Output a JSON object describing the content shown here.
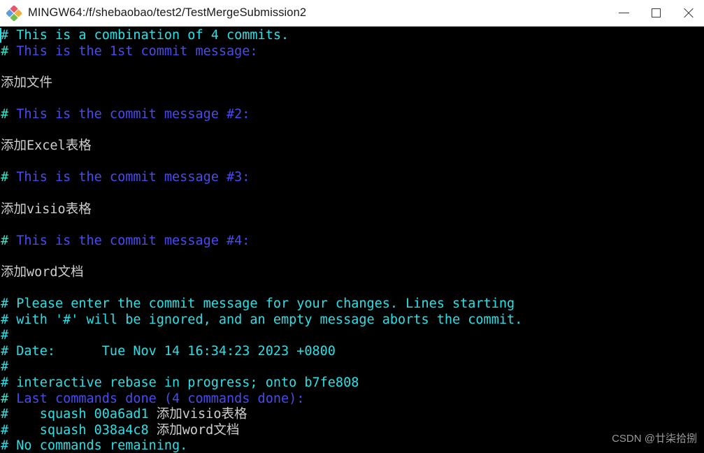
{
  "window": {
    "title": "MINGW64:/f/shebaobao/test2/TestMergeSubmission2",
    "icon": "git-bash-icon",
    "controls": {
      "minimize": "minimize-icon",
      "maximize": "maximize-icon",
      "close": "close-icon"
    }
  },
  "colors": {
    "titlebar_bg": "#ffffff",
    "titlebar_text": "#1a1a1a",
    "terminal_bg": "#000000",
    "comment_hash": "#2ee6c8",
    "cyan": "#2ae0e6",
    "blue": "#4a4aee",
    "message_text": "#cfcfcf",
    "watermark": "#9b9b9b"
  },
  "terminal": {
    "lines": [
      {
        "segments": [
          {
            "text": "# This is a combination of 4 commits.",
            "color": "cyan"
          }
        ]
      },
      {
        "segments": [
          {
            "text": "#",
            "color": "hash"
          },
          {
            "text": " This is the 1st commit message:",
            "color": "blue"
          }
        ]
      },
      {
        "segments": [
          {
            "text": "",
            "color": "blank"
          }
        ]
      },
      {
        "segments": [
          {
            "text": "添加文件",
            "color": "text"
          }
        ]
      },
      {
        "segments": [
          {
            "text": "",
            "color": "blank"
          }
        ]
      },
      {
        "segments": [
          {
            "text": "#",
            "color": "hash"
          },
          {
            "text": " This is the commit message #2:",
            "color": "blue"
          }
        ]
      },
      {
        "segments": [
          {
            "text": "",
            "color": "blank"
          }
        ]
      },
      {
        "segments": [
          {
            "text": "添加Excel表格",
            "color": "text"
          }
        ]
      },
      {
        "segments": [
          {
            "text": "",
            "color": "blank"
          }
        ]
      },
      {
        "segments": [
          {
            "text": "#",
            "color": "hash"
          },
          {
            "text": " This is the commit message #3:",
            "color": "blue"
          }
        ]
      },
      {
        "segments": [
          {
            "text": "",
            "color": "blank"
          }
        ]
      },
      {
        "segments": [
          {
            "text": "添加visio表格",
            "color": "text"
          }
        ]
      },
      {
        "segments": [
          {
            "text": "",
            "color": "blank"
          }
        ]
      },
      {
        "segments": [
          {
            "text": "#",
            "color": "hash"
          },
          {
            "text": " This is the commit message #4:",
            "color": "blue"
          }
        ]
      },
      {
        "segments": [
          {
            "text": "",
            "color": "blank"
          }
        ]
      },
      {
        "segments": [
          {
            "text": "添加word文档",
            "color": "text"
          }
        ]
      },
      {
        "segments": [
          {
            "text": "",
            "color": "blank"
          }
        ]
      },
      {
        "segments": [
          {
            "text": "# Please enter the commit message for your changes. Lines starting",
            "color": "cyan"
          }
        ]
      },
      {
        "segments": [
          {
            "text": "# with '#' will be ignored, and an empty message aborts the commit.",
            "color": "cyan"
          }
        ]
      },
      {
        "segments": [
          {
            "text": "#",
            "color": "cyan"
          }
        ]
      },
      {
        "segments": [
          {
            "text": "# Date:      Tue Nov 14 16:34:23 2023 +0800",
            "color": "cyan"
          }
        ]
      },
      {
        "segments": [
          {
            "text": "#",
            "color": "cyan"
          }
        ]
      },
      {
        "segments": [
          {
            "text": "# interactive rebase in progress; onto b7fe808",
            "color": "cyan"
          }
        ]
      },
      {
        "segments": [
          {
            "text": "#",
            "color": "hash"
          },
          {
            "text": " Last commands done (4 commands done):",
            "color": "blue"
          }
        ]
      },
      {
        "segments": [
          {
            "text": "#    squash 00a6ad1 ",
            "color": "cyan"
          },
          {
            "text": "添加visio表格",
            "color": "text"
          }
        ]
      },
      {
        "segments": [
          {
            "text": "#    squash 038a4c8 ",
            "color": "cyan"
          },
          {
            "text": "添加word文档",
            "color": "text"
          }
        ]
      },
      {
        "segments": [
          {
            "text": "# No commands remaining.",
            "color": "cyan"
          }
        ]
      }
    ]
  },
  "watermark": {
    "text": "CSDN @廿柒拾捌"
  }
}
